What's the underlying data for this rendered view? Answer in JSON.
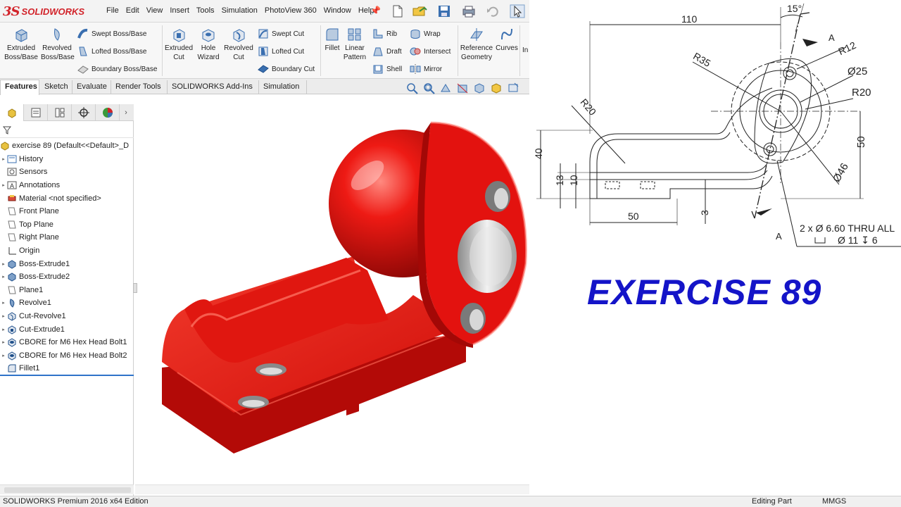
{
  "app": {
    "logo_brand": "SOLIDWORKS",
    "brand_color": "#d2232a",
    "menu": [
      "File",
      "Edit",
      "View",
      "Insert",
      "Tools",
      "Simulation",
      "PhotoView 360",
      "Window",
      "Help"
    ]
  },
  "ribbon": {
    "extruded_boss": "Extruded Boss/Base",
    "revolved_boss": "Revolved Boss/Base",
    "swept_boss": "Swept Boss/Base",
    "lofted_boss": "Lofted Boss/Base",
    "boundary_boss": "Boundary Boss/Base",
    "extruded_cut": "Extruded Cut",
    "hole_wizard": "Hole Wizard",
    "revolved_cut": "Revolved Cut",
    "swept_cut": "Swept Cut",
    "lofted_cut": "Lofted Cut",
    "boundary_cut": "Boundary Cut",
    "fillet": "Fillet",
    "linear_pattern": "Linear Pattern",
    "rib": "Rib",
    "draft": "Draft",
    "shell": "Shell",
    "wrap": "Wrap",
    "intersect": "Intersect",
    "mirror": "Mirror",
    "reference_geometry": "Reference Geometry",
    "curves": "Curves",
    "overflow": "In"
  },
  "tabs": [
    "Features",
    "Sketch",
    "Evaluate",
    "Render Tools",
    "SOLIDWORKS Add-Ins",
    "Simulation"
  ],
  "active_tab": "Features",
  "tree": {
    "root": "exercise 89  (Default<<Default>_D",
    "items": [
      {
        "label": "History",
        "icon": "history-icon",
        "expand": true
      },
      {
        "label": "Sensors",
        "icon": "sensors-icon",
        "expand": false
      },
      {
        "label": "Annotations",
        "icon": "annotations-icon",
        "expand": true
      },
      {
        "label": "Material <not specified>",
        "icon": "material-icon",
        "expand": false
      },
      {
        "label": "Front Plane",
        "icon": "plane-icon",
        "expand": false
      },
      {
        "label": "Top Plane",
        "icon": "plane-icon",
        "expand": false
      },
      {
        "label": "Right Plane",
        "icon": "plane-icon",
        "expand": false
      },
      {
        "label": "Origin",
        "icon": "origin-icon",
        "expand": false
      },
      {
        "label": "Boss-Extrude1",
        "icon": "extrude-icon",
        "expand": true
      },
      {
        "label": "Boss-Extrude2",
        "icon": "extrude-icon",
        "expand": true
      },
      {
        "label": "Plane1",
        "icon": "plane-icon",
        "expand": false
      },
      {
        "label": "Revolve1",
        "icon": "revolve-icon",
        "expand": true
      },
      {
        "label": "Cut-Revolve1",
        "icon": "cut-revolve-icon",
        "expand": true
      },
      {
        "label": "Cut-Extrude1",
        "icon": "cut-extrude-icon",
        "expand": true
      },
      {
        "label": "CBORE for M6 Hex Head Bolt1",
        "icon": "hole-icon",
        "expand": true
      },
      {
        "label": "CBORE for M6 Hex Head Bolt2",
        "icon": "hole-icon",
        "expand": true
      },
      {
        "label": "Fillet1",
        "icon": "fillet-icon",
        "expand": false
      }
    ]
  },
  "status": {
    "left": "SOLIDWORKS Premium 2016 x64 Edition",
    "mode": "Editing Part",
    "units": "MMGS"
  },
  "drawing": {
    "dim_110": "110",
    "angle_15": "15°",
    "section_a_top": "A",
    "section_a_bottom": "A",
    "r12": "R12",
    "r35": "R35",
    "dia25": "Ø25",
    "r20_right": "R20",
    "r20_left": "R20",
    "dim_50_right": "50",
    "dim_40": "40",
    "dim_13": "13",
    "dim_10": "10",
    "dia46": "Ø46",
    "dim_50_bottom": "50",
    "dim_3": "3",
    "hole_note_1": "2 x Ø 6.60 THRU ALL",
    "hole_note_2": "Ø 11 ↧ 6"
  },
  "title": "EXERCISE 89",
  "colors": {
    "part_red": "#e3120f",
    "title_blue": "#1414c8"
  }
}
